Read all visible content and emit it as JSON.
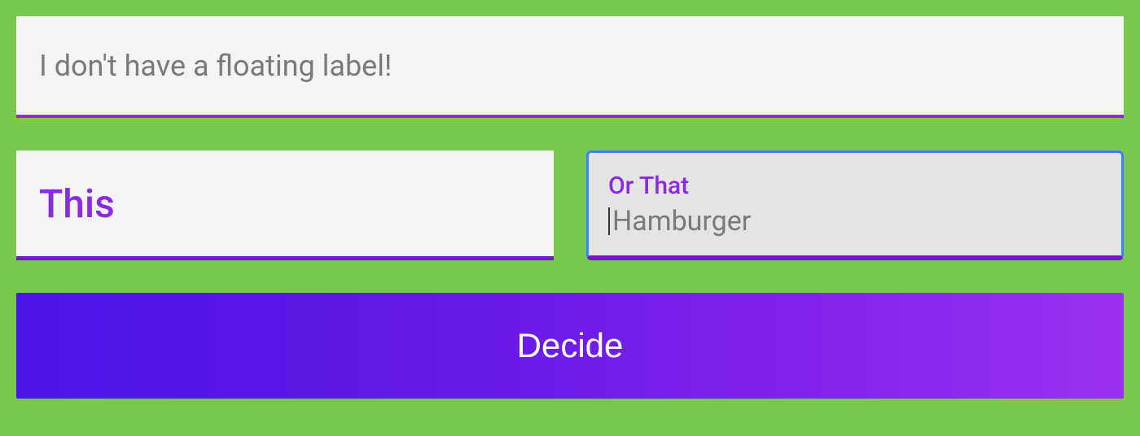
{
  "fields": {
    "no_float": {
      "placeholder": "I don't have a floating label!",
      "value": ""
    },
    "this": {
      "label": "This",
      "value": ""
    },
    "or_that": {
      "label": "Or That",
      "placeholder": "Hamburger",
      "value": "",
      "focused": true
    }
  },
  "button": {
    "decide_label": "Decide"
  },
  "colors": {
    "background": "#7ac74f",
    "accent": "#8a2be2",
    "focus_outline": "#3b82f6",
    "button_gradient_start": "#4b14e6",
    "button_gradient_end": "#9b2ff0"
  }
}
